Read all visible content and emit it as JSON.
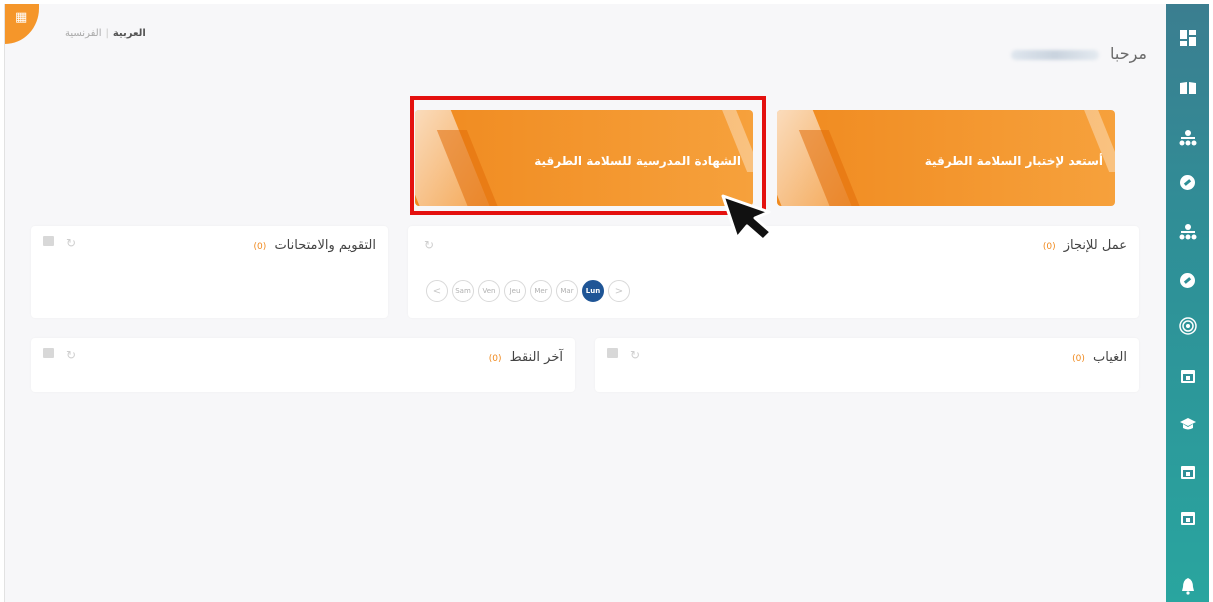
{
  "language": {
    "arabic": "العربية",
    "separator": "|",
    "french": "الفرنسية"
  },
  "greeting": {
    "prefix": "مرحبا"
  },
  "banners": [
    {
      "label": "أستعد لإختبار السلامة الطرقية"
    },
    {
      "label": "الشهادة المدرسية للسلامة الطرقية"
    }
  ],
  "cards": {
    "todo": {
      "title": "عمل للإنجاز",
      "count": "(0)"
    },
    "exams": {
      "title": "التقويم والامتحانات",
      "count": "(0)"
    },
    "absence": {
      "title": "الغياب",
      "count": "(0)"
    },
    "grades": {
      "title": "آخر النقط",
      "count": "(0)"
    }
  },
  "days": {
    "prev": "<",
    "next": ">",
    "items": [
      "Sam",
      "Ven",
      "Jeu",
      "Mer",
      "Mar",
      "Lun"
    ],
    "active": "Lun"
  },
  "icons": {
    "refresh": "↻",
    "sidebar": [
      "dashboard-icon",
      "book-icon",
      "hierarchy-icon",
      "compass-icon",
      "hierarchy-icon",
      "compass-icon",
      "target-icon",
      "calendar-icon",
      "graduation-cap-icon",
      "calendar-icon",
      "calendar-icon",
      "bell-icon"
    ]
  },
  "colors": {
    "accent": "#f08a1f",
    "sidebar": "#2f8f97",
    "active_day": "#1f5596",
    "highlight": "#e4110f"
  }
}
